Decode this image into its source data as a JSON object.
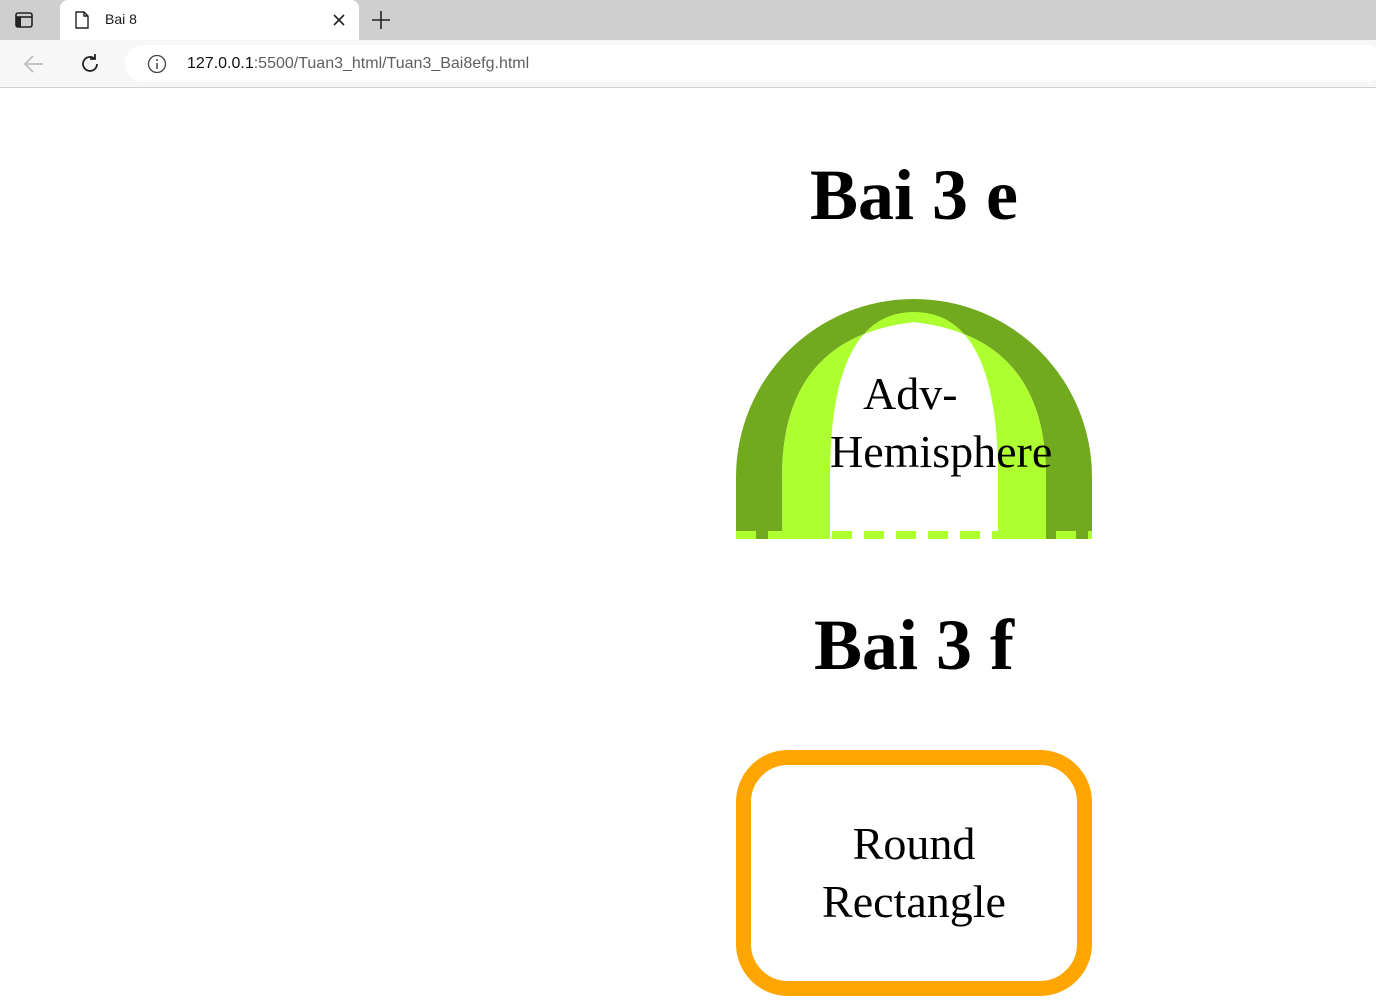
{
  "browser": {
    "tab": {
      "title": "Bai 8"
    },
    "address": {
      "host": "127.0.0.1",
      "path": ":5500/Tuan3_html/Tuan3_Bai8efg.html"
    },
    "icons": {
      "tab_actions": "tab-actions-icon",
      "favicon": "page-icon",
      "close": "close-icon",
      "new_tab": "plus-icon",
      "back": "arrow-left-icon",
      "reload": "reload-icon",
      "info": "info-icon"
    }
  },
  "page": {
    "section_e": {
      "heading": "Bai 3 e",
      "shape_label_line1": "Adv-",
      "shape_label_line2": "Hemisphere",
      "colors": {
        "outer": "#72aa1f",
        "inner": "#adff2f"
      }
    },
    "section_f": {
      "heading": "Bai 3 f",
      "shape_label_line1": "Round",
      "shape_label_line2": "Rectangle",
      "colors": {
        "border": "#ffa500"
      }
    }
  }
}
